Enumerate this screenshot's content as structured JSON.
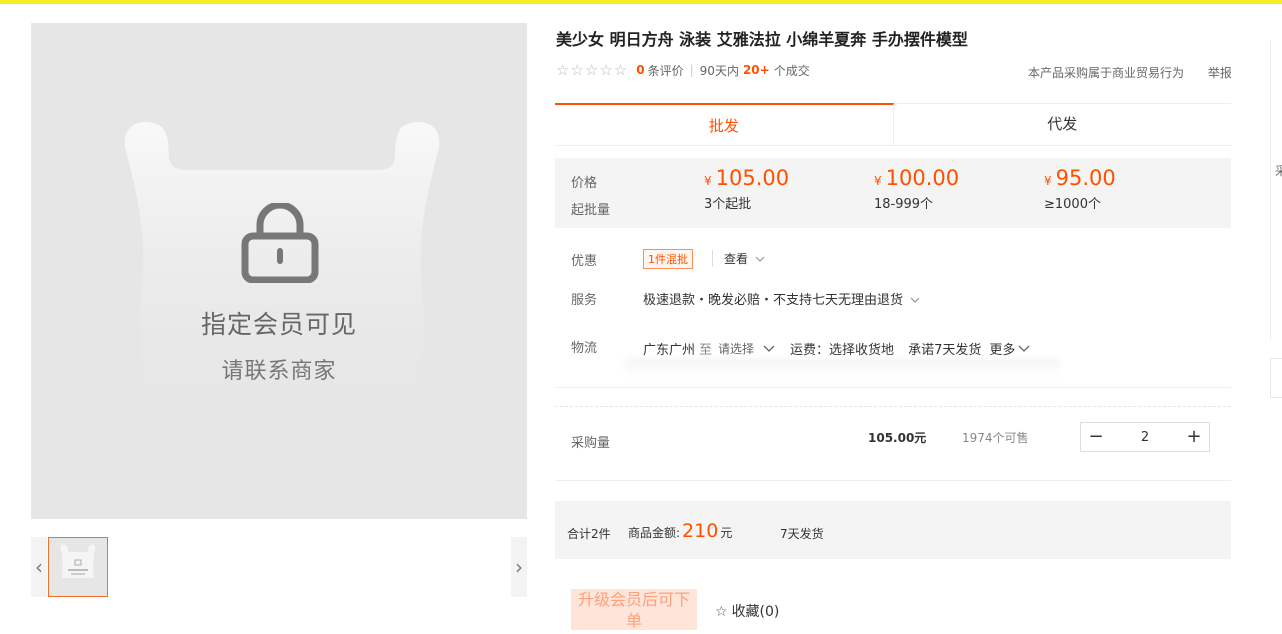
{
  "product": {
    "title": "美少女 明日方舟 泳装 艾雅法拉 小绵羊夏奔 手办摆件模型",
    "stars": "☆☆☆☆☆",
    "review_count": "0",
    "review_suffix": "条评价",
    "deal_prefix": "90天内",
    "deal_count": "20+",
    "deal_suffix": "个成交",
    "business_notice": "本产品采购属于商业贸易行为",
    "report_label": "举报"
  },
  "gallery": {
    "restricted_title": "指定会员可见",
    "restricted_subtitle": "请联系商家",
    "prev_glyph": "‹",
    "next_glyph": "›"
  },
  "tabs": [
    {
      "label": "批发",
      "active": true
    },
    {
      "label": "代发",
      "active": false
    }
  ],
  "pricing": {
    "price_label": "价格",
    "moq_label": "起批量",
    "currency": "¥",
    "tiers": [
      {
        "price": "105.00",
        "qty": "3个起批"
      },
      {
        "price": "100.00",
        "qty": "18-999个"
      },
      {
        "price": "95.00",
        "qty": "≥1000个"
      }
    ]
  },
  "offers": {
    "label": "优惠",
    "tag": "1件混批",
    "view_label": "查看"
  },
  "service": {
    "label": "服务",
    "text": "极速退款・晚发必赔・不支持七天无理由退货"
  },
  "logistics": {
    "label": "物流",
    "origin": "广东广州",
    "to": "至",
    "destination_placeholder": "请选择",
    "freight": "运费：选择收货地",
    "promise": "承诺7天发货",
    "more": "更多"
  },
  "purchase": {
    "label": "采购量",
    "total": "105.00元",
    "stock": "1974个可售",
    "minus": "−",
    "plus": "+",
    "quantity": "2"
  },
  "summary": {
    "count": "合计2件",
    "amount_label": "商品金额:",
    "amount": "210",
    "amount_unit": "元",
    "delivery": "7天发货"
  },
  "actions": {
    "upgrade_label": "升级会员后可下单",
    "favorite_label": "收藏(0)",
    "favorite_icon": "☆"
  },
  "edge": {
    "glyph": "采"
  },
  "colors": {
    "accent": "#ff5000",
    "topbar": "#f5ef28"
  }
}
